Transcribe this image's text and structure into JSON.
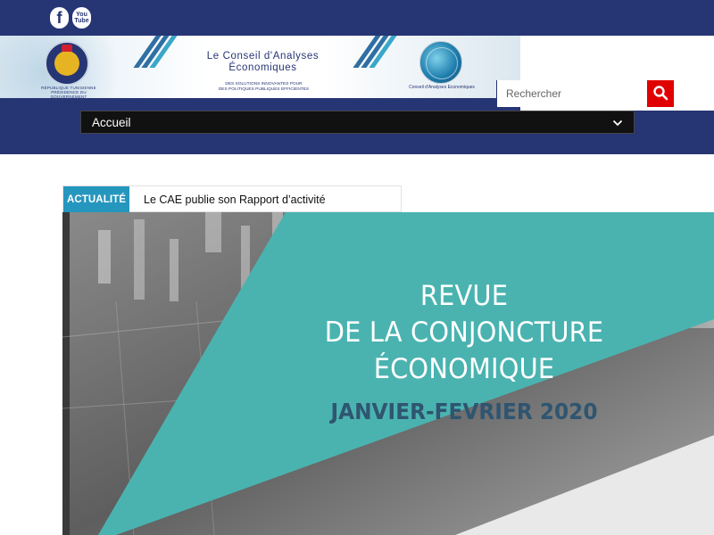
{
  "social": {
    "facebook_icon": "f",
    "youtube_icon_top": "You",
    "youtube_icon_bottom": "Tube"
  },
  "header": {
    "banner_title_line1": "Le Conseil d'Analyses",
    "banner_title_line2": "Économiques",
    "banner_subtitle_line1": "DES SOLUTIONS INNOVANTES POUR",
    "banner_subtitle_line2": "DES POLITIQUES PUBLIQUES EFFICIENTES",
    "seal_caption_line1": "RÉPUBLIQUE TUNISIENNE",
    "seal_caption_line2": "PRÉSIDENCE DU GOUVERNEMENT",
    "globe_caption": "Conseil d'Analyses Economiques"
  },
  "search": {
    "placeholder": "Rechercher",
    "icon": "search-icon"
  },
  "nav": {
    "selected": "Accueil",
    "icon": "chevron-down-icon"
  },
  "news": {
    "tag": "ACTUALITÉ",
    "headline": "Le CAE publie son Rapport d’activité"
  },
  "hero": {
    "title_line1": "REVUE",
    "title_line2": "DE LA CONJONCTURE",
    "title_line3": "ÉCONOMIQUE",
    "subtitle": "JANVIER-FEVRIER 2020"
  },
  "colors": {
    "header_bg": "#263574",
    "search_button": "#e10000",
    "news_tag": "#2596be",
    "hero_teal": "#4ab3b0"
  }
}
